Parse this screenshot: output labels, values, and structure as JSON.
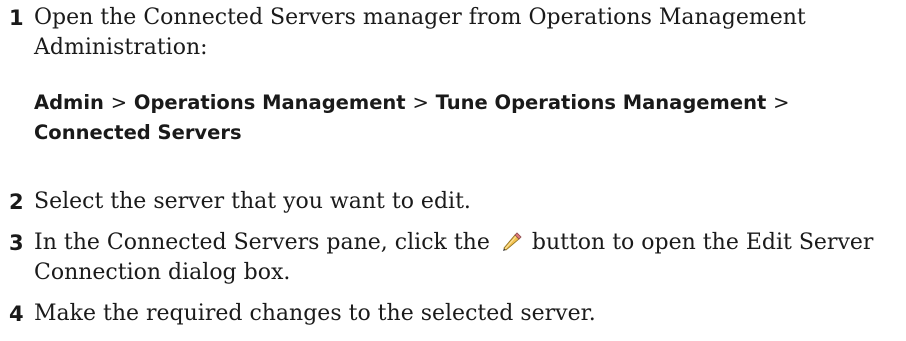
{
  "steps": [
    {
      "number": "1",
      "text": "Open the Connected Servers manager from Operations Management Administration:"
    },
    {
      "number": "2",
      "text": "Select the server that you want to edit."
    },
    {
      "number": "3",
      "text_before": "In the Connected Servers pane, click the",
      "icon": "pencil-icon",
      "text_after": "button to open the Edit Server Connection dialog box."
    },
    {
      "number": "4",
      "text": "Make the required changes to the selected server."
    }
  ],
  "menu_path": {
    "items": [
      "Admin",
      "Operations Management",
      "Tune Operations Management",
      "Connected Servers"
    ],
    "separator": ">"
  }
}
